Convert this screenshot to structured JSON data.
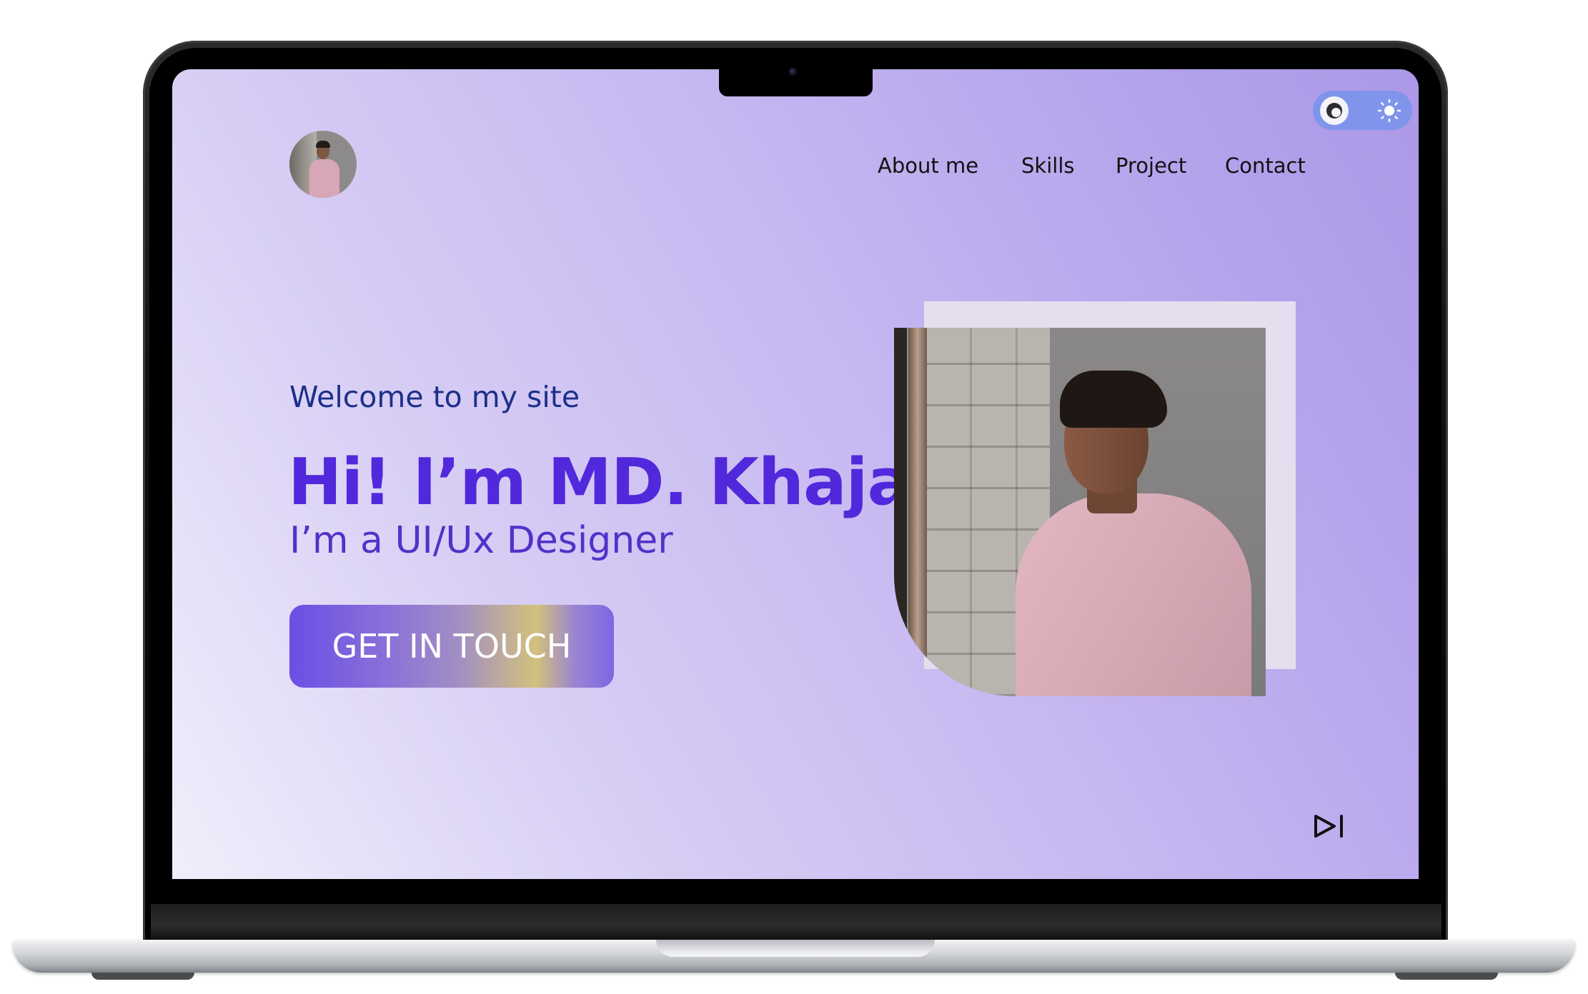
{
  "nav": {
    "items": [
      {
        "label": "About me"
      },
      {
        "label": "Skills"
      },
      {
        "label": "Project"
      },
      {
        "label": "Contact"
      }
    ]
  },
  "theme_toggle": {
    "options": [
      "moon-icon",
      "sun-icon"
    ],
    "selected": "dark"
  },
  "hero": {
    "welcome": "Welcome to my site",
    "headline": "Hi! I’m MD. Khaja",
    "subline": "I’m a UI/Ux Designer",
    "cta_label": "GET IN TOUCH"
  },
  "icons": {
    "avatar": "profile-photo",
    "portrait": "portrait-photo",
    "skip": "skip-forward-icon"
  },
  "colors": {
    "headline": "#5128dc",
    "welcome": "#1d2f8a",
    "toggle_bg": "#7f94ea",
    "screen_gradient_start": "#f1eefb",
    "screen_gradient_end": "#ab98e8"
  }
}
